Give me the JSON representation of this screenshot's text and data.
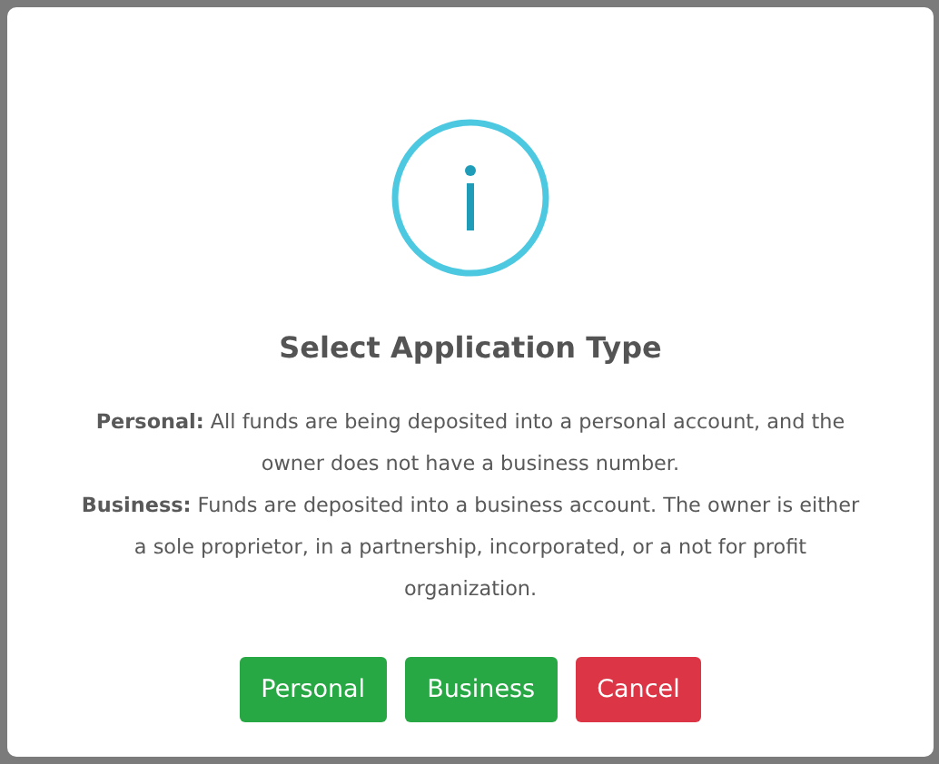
{
  "dialog": {
    "title": "Select Application Type",
    "paragraphs": [
      "**Personal:** All funds are being deposited into a personal account, and the owner does not have a business number.",
      "**Business:** Funds are deposited into a business account. The owner is either a sole proprietor, in a partnership, incorporated, or a not for profit organization."
    ],
    "buttons": [
      {
        "label": "Personal",
        "kind": "confirm"
      },
      {
        "label": "Business",
        "kind": "confirm"
      },
      {
        "label": "Cancel",
        "kind": "cancel"
      }
    ]
  }
}
